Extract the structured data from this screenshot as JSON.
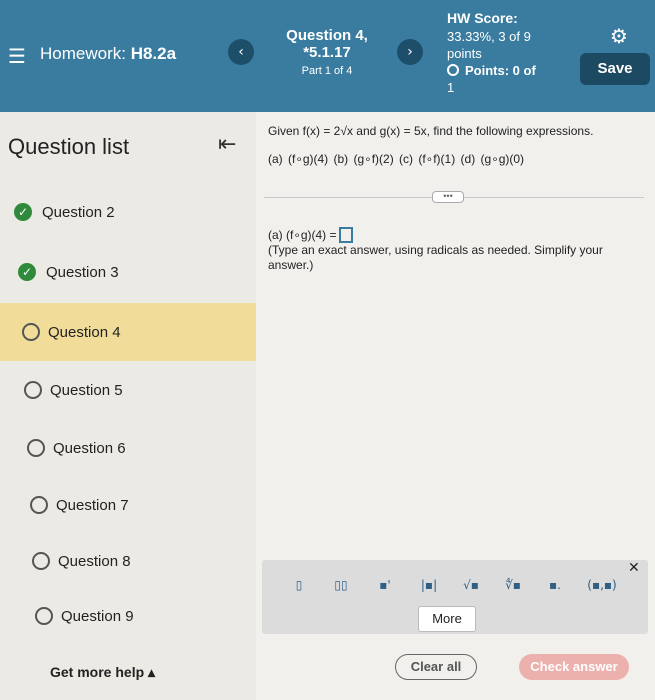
{
  "header": {
    "menu_icon": "hamburger-icon",
    "hw_prefix": "Homework: ",
    "hw_name": "H8.2a",
    "question_title": "Question 4,",
    "question_number": "*5.1.17",
    "part": "Part 1 of 4",
    "score_label": "HW Score:",
    "score_value": "33.33%, 3 of 9 points",
    "points": "Points: 0 of",
    "points_total": "1",
    "save": "Save",
    "prev_icon": "chevron-left-icon",
    "next_icon": "chevron-right-icon",
    "settings_icon": "gear-icon"
  },
  "sidebar": {
    "title": "Question list",
    "collapse_icon": "collapse-left-icon",
    "items": [
      {
        "label": "Question 2",
        "status": "done"
      },
      {
        "label": "Question 3",
        "status": "done"
      },
      {
        "label": "Question 4",
        "status": "current"
      },
      {
        "label": "Question 5",
        "status": "open"
      },
      {
        "label": "Question 6",
        "status": "open"
      },
      {
        "label": "Question 7",
        "status": "open"
      },
      {
        "label": "Question 8",
        "status": "open"
      },
      {
        "label": "Question 9",
        "status": "open"
      }
    ],
    "help": "Get more help ▴"
  },
  "question": {
    "given": "Given f(x) = 2√x and g(x) = 5x, find the following expressions.",
    "parts": "(a) (f∘g)(4)   (b) (g∘f)(2)   (c) (f∘f)(1)   (d) (g∘g)(0)",
    "prompt": "(a) (f∘g)(4) =",
    "note": "(Type an exact answer, using radicals as needed. Simplify your answer.)"
  },
  "toolbar": {
    "tools": [
      "fraction-icon",
      "mixed-number-icon",
      "exponent-icon",
      "absolute-value-icon",
      "square-root-icon",
      "nth-root-icon",
      "decimal-icon",
      "ordered-pair-icon"
    ],
    "tool_glyphs": [
      "▯",
      "▯▯",
      "▪'",
      "|▪|",
      "√▪",
      "∜▪",
      "▪.",
      "(▪,▪)"
    ],
    "more": "More",
    "close_icon": "close-icon"
  },
  "actions": {
    "clear": "Clear all",
    "check": "Check answer"
  },
  "colors": {
    "header": "#3a7ca0",
    "current_question": "#f1dc9a",
    "done": "#2f8a3c",
    "check_button": "#ecb0ad"
  }
}
